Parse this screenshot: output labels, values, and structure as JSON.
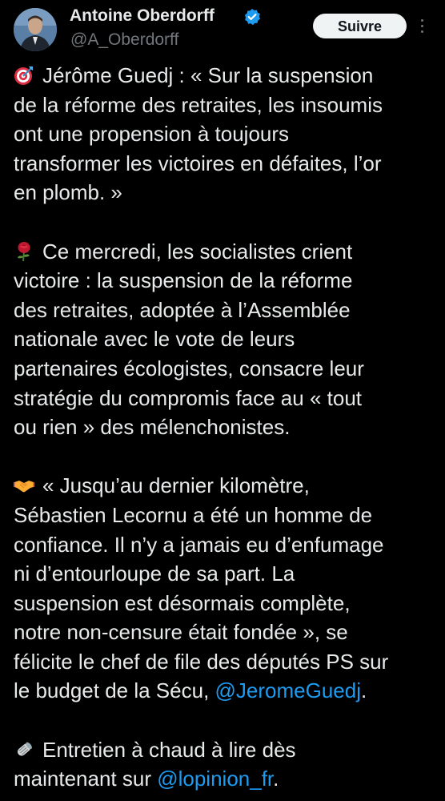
{
  "author": {
    "name": "Antoine Oberdorff",
    "handle": "@A_Oberdorff"
  },
  "follow_label": "Suivre",
  "icons": {
    "verified": "verified-badge-icon",
    "more": "more-options-icon",
    "target": "direct-hit-emoji",
    "rose": "rose-emoji",
    "handshake": "handshake-emoji",
    "newspaper": "rolled-newspaper-emoji"
  },
  "colors": {
    "background": "#000000",
    "text": "#e7e9ea",
    "secondary": "#71767b",
    "link": "#1d9bf0",
    "verified": "#1d9bf0"
  },
  "tweet": {
    "p1": [
      "Jérôme Guedj : « Sur la suspension",
      "de la réforme des retraites, les insoumis",
      "ont une propension à toujours",
      "transformer les victoires en défaites, l’or",
      "en plomb. »"
    ],
    "p2": [
      "Ce mercredi, les socialistes crient",
      "victoire : la suspension de la réforme",
      "des retraites, adoptée à l’Assemblée",
      "nationale avec le vote de leurs",
      "partenaires écologistes, consacre leur",
      "stratégie du compromis face au « tout",
      "ou rien » des mélenchonistes."
    ],
    "p3": [
      "« Jusqu’au dernier kilomètre,",
      "Sébastien Lecornu a été un homme de",
      "confiance. Il n’y a jamais eu d’enfumage",
      "ni d’entourloupe de sa part. La",
      "suspension est désormais complète,",
      "notre non-censure était fondée », se",
      "félicite le chef de file des députés PS sur"
    ],
    "p3_last": "le budget de la Sécu, ",
    "p3_mention": "@JeromeGuedj",
    "p3_end": ".",
    "p4_line1": "Entretien à chaud à lire dès",
    "p4_line2": "maintenant sur ",
    "p4_mention": "@lopinion_fr",
    "p4_end": "."
  }
}
